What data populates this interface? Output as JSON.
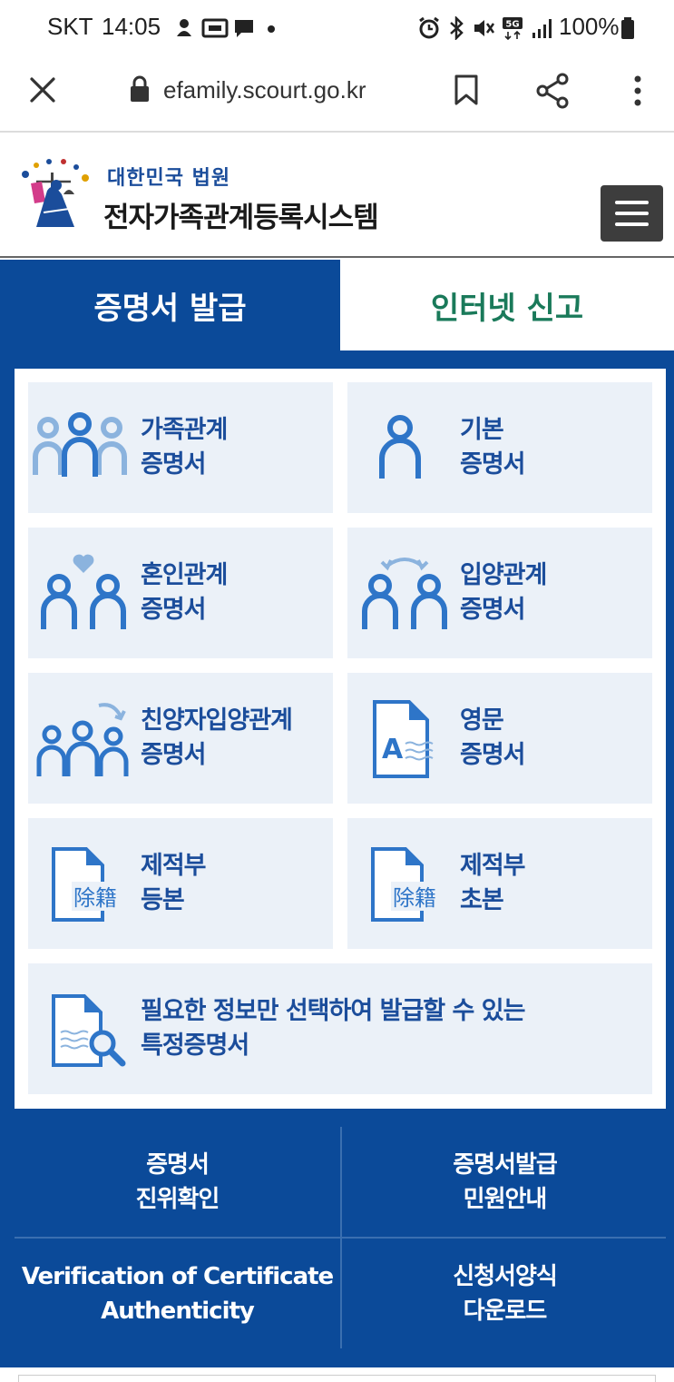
{
  "status_bar": {
    "carrier": "SKT",
    "time": "14:05",
    "network": "5G",
    "battery": "100%"
  },
  "browser": {
    "url": "efamily.scourt.go.kr",
    "icons": [
      "close-icon",
      "lock-icon",
      "bookmark-icon",
      "share-icon",
      "more-vert-icon"
    ]
  },
  "site": {
    "org_name": "대한민국 법원",
    "system_name": "전자가족관계등록시스템"
  },
  "tabs": [
    {
      "label": "증명서 발급",
      "active": true
    },
    {
      "label": "인터넷 신고",
      "active": false
    }
  ],
  "certificates": [
    {
      "line1": "가족관계",
      "line2": "증명서",
      "icon": "family-icon"
    },
    {
      "line1": "기본",
      "line2": "증명서",
      "icon": "person-icon"
    },
    {
      "line1": "혼인관계",
      "line2": "증명서",
      "icon": "marriage-icon"
    },
    {
      "line1": "입양관계",
      "line2": "증명서",
      "icon": "adoption-icon"
    },
    {
      "line1": "친양자입양관계",
      "line2": "증명서",
      "icon": "full-adoption-icon"
    },
    {
      "line1": "영문",
      "line2": "증명서",
      "icon": "english-document-icon"
    },
    {
      "line1": "제적부",
      "line2": "등본",
      "icon": "removed-register-document-icon",
      "badge": "除籍"
    },
    {
      "line1": "제적부",
      "line2": "초본",
      "icon": "removed-register-document-icon",
      "badge": "除籍"
    },
    {
      "line1": "필요한 정보만 선택하여 발급할 수 있는",
      "line2": "특정증명서",
      "icon": "document-search-icon"
    }
  ],
  "bottom_links": [
    {
      "line1": "증명서",
      "line2": "진위확인"
    },
    {
      "line1": "증명서발급",
      "line2": "민원안내"
    },
    {
      "line1": "Verification of Certificate",
      "line2": "Authenticity"
    },
    {
      "line1": "신청서양식",
      "line2": "다운로드"
    }
  ],
  "colors": {
    "primary_blue": "#0b4a99",
    "card_bg": "#ebf1f8",
    "label_blue": "#1b4d9b",
    "tab_green": "#1a7a5a"
  }
}
